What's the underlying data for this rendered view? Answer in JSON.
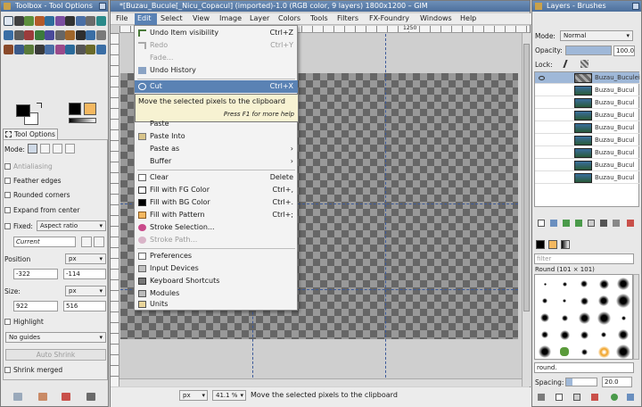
{
  "toolbox": {
    "title": "Toolbox - Tool Options"
  },
  "tool_options": {
    "tab_label": "Tool Options",
    "mode_label": "Mode:",
    "antialiasing": "Antialiasing",
    "feather_edges": "Feather edges",
    "rounded_corners": "Rounded corners",
    "expand_from_center": "Expand from center",
    "fixed_label": "Fixed:",
    "fixed_value": "Aspect ratio",
    "current_value": "Current",
    "position_label": "Position",
    "position_unit": "px",
    "position_x": "-322",
    "position_y": "-114",
    "size_label": "Size:",
    "size_unit": "px",
    "size_w": "922",
    "size_h": "516",
    "highlight": "Highlight",
    "guides_value": "No guides",
    "auto_shrink": "Auto Shrink",
    "shrink_merged": "Shrink merged"
  },
  "image_window": {
    "title": "*[Buzau_Bucule[_Nicu_Copacul] (imported)-1.0 (RGB color, 9 layers) 1800x1200 – GIM",
    "menu": [
      "File",
      "Edit",
      "Select",
      "View",
      "Image",
      "Layer",
      "Colors",
      "Tools",
      "Filters",
      "FX-Foundry",
      "Windows",
      "Help"
    ],
    "ruler_labels": [
      "1250"
    ],
    "status_unit": "px",
    "zoom": "41.1 %",
    "status_message": "Move the selected pixels to the clipboard"
  },
  "edit_menu": {
    "items": [
      {
        "label": "Undo Item visibility",
        "shortcut": "Ctrl+Z",
        "disabled": false
      },
      {
        "label": "Redo",
        "shortcut": "Ctrl+Y",
        "disabled": true
      },
      {
        "label": "Fade...",
        "shortcut": "",
        "disabled": true
      },
      {
        "label": "Undo History",
        "shortcut": "",
        "disabled": false
      },
      {
        "label": "Cut",
        "shortcut": "Ctrl+X",
        "disabled": false
      },
      {
        "label": "Paste",
        "shortcut": "",
        "disabled": false
      },
      {
        "label": "Paste Into",
        "shortcut": "",
        "disabled": false
      },
      {
        "label": "Paste as",
        "shortcut": "",
        "disabled": false
      },
      {
        "label": "Buffer",
        "shortcut": "",
        "disabled": false
      },
      {
        "label": "Clear",
        "shortcut": "Delete",
        "disabled": false
      },
      {
        "label": "Fill with FG Color",
        "shortcut": "Ctrl+,",
        "disabled": false
      },
      {
        "label": "Fill with BG Color",
        "shortcut": "Ctrl+.",
        "disabled": false
      },
      {
        "label": "Fill with Pattern",
        "shortcut": "Ctrl+;",
        "disabled": false
      },
      {
        "label": "Stroke Selection...",
        "shortcut": "",
        "disabled": false
      },
      {
        "label": "Stroke Path...",
        "shortcut": "",
        "disabled": true
      },
      {
        "label": "Preferences",
        "shortcut": "",
        "disabled": false
      },
      {
        "label": "Input Devices",
        "shortcut": "",
        "disabled": false
      },
      {
        "label": "Keyboard Shortcuts",
        "shortcut": "",
        "disabled": false
      },
      {
        "label": "Modules",
        "shortcut": "",
        "disabled": false
      },
      {
        "label": "Units",
        "shortcut": "",
        "disabled": false
      }
    ],
    "tooltip_title": "Move the selected pixels to the clipboard",
    "tooltip_hint": "Press F1 for more help"
  },
  "layers_panel": {
    "title": "Layers - Brushes",
    "mode_label": "Mode:",
    "mode_value": "Normal",
    "opacity_label": "Opacity:",
    "opacity_value": "100.0",
    "lock_label": "Lock:",
    "layer_names": [
      "Buzau_Buculei",
      "Buzau_Bucul",
      "Buzau_Bucul",
      "Buzau_Bucul",
      "Buzau_Bucul",
      "Buzau_Bucul",
      "Buzau_Bucul",
      "Buzau_Bucul",
      "Buzau_Bucul"
    ],
    "filter_placeholder": "filter",
    "brush_name": "Round (101 × 101)",
    "brush_search": "round.",
    "spacing_label": "Spacing:",
    "spacing_value": "20.0"
  },
  "colors": {
    "accent": "#5a82b4",
    "selection": "#9fb8d8",
    "canvas_dark": "#666666",
    "canvas_light": "#999999"
  }
}
